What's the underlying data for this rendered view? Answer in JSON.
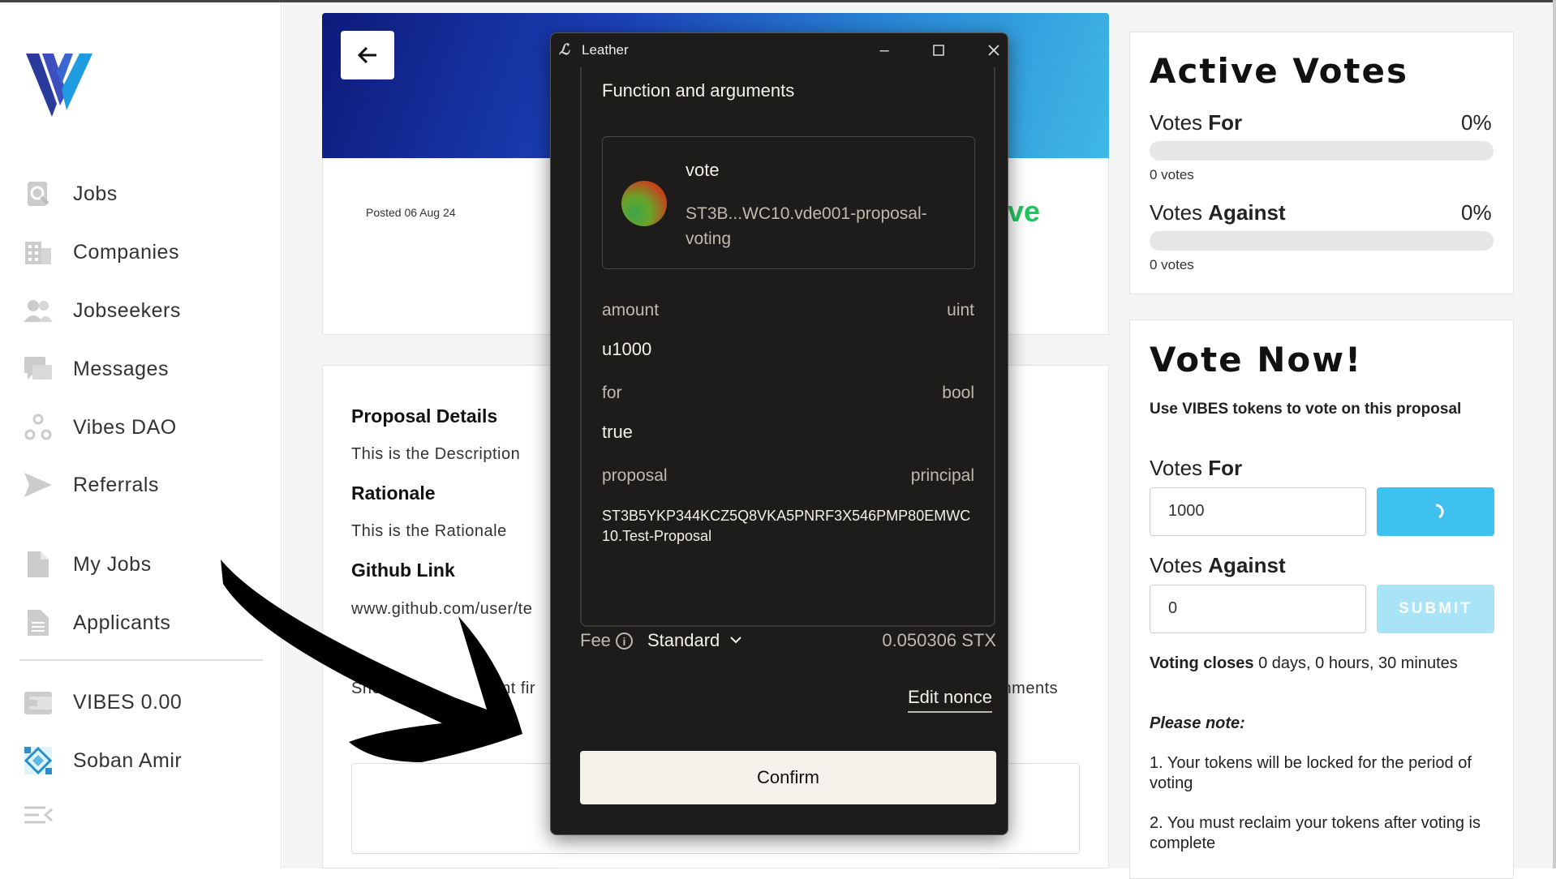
{
  "sidebar": {
    "items": [
      {
        "label": "Jobs",
        "icon": "search-icon"
      },
      {
        "label": "Companies",
        "icon": "building-icon"
      },
      {
        "label": "Jobseekers",
        "icon": "users-icon"
      },
      {
        "label": "Messages",
        "icon": "chat-icon"
      },
      {
        "label": "Vibes DAO",
        "icon": "dao-icon"
      },
      {
        "label": "Referrals",
        "icon": "send-icon"
      },
      {
        "label": "My Jobs",
        "icon": "document-icon"
      },
      {
        "label": "Applicants",
        "icon": "document-lines-icon"
      },
      {
        "label": "VIBES 0.00",
        "icon": "wallet-icon"
      },
      {
        "label": "Soban Amir",
        "icon": "avatar"
      }
    ]
  },
  "proposal": {
    "posted": "Posted 06 Aug 24",
    "status_fragment": "tive",
    "details_heading": "Proposal Details",
    "description": "This is the Description",
    "rationale_heading": "Rationale",
    "rationale": "This is the Rationale",
    "github_heading": "Github Link",
    "github_link": "www.github.com/user/te",
    "show_left": "Show",
    "show_middle": "cent fir",
    "comments_fragment": "mments"
  },
  "active_votes": {
    "title": "Active Votes",
    "for_prefix": "Votes ",
    "for_bold": "For",
    "for_pct": "0%",
    "for_count": "0 votes",
    "against_prefix": "Votes ",
    "against_bold": "Against",
    "against_pct": "0%",
    "against_count": "0 votes"
  },
  "vote_now": {
    "title": "Vote Now!",
    "subtitle": "Use VIBES tokens to vote on this proposal",
    "for_prefix": "Votes ",
    "for_bold": "For",
    "for_value": "1000",
    "against_prefix": "Votes ",
    "against_bold": "Against",
    "against_value": "0",
    "submit_label": "SUBMIT",
    "closes_bold": "Voting closes",
    "closes_rest": " 0 days, 0 hours, 30 minutes",
    "note_heading": "Please note:",
    "note_1": "1. Your tokens will be locked for the period of voting",
    "note_2": "2. You must reclaim your tokens after voting is complete"
  },
  "leather": {
    "app_name": "Leather",
    "section_title": "Function and arguments",
    "function_name": "vote",
    "contract": "ST3B...WC10.vde001-proposal-voting",
    "args": [
      {
        "name": "amount",
        "type": "uint",
        "value": "u1000"
      },
      {
        "name": "for",
        "type": "bool",
        "value": "true"
      },
      {
        "name": "proposal",
        "type": "principal",
        "value": "ST3B5YKP344KCZ5Q8VKA5PNRF3X546PMP80EMWC10.Test-Proposal"
      }
    ],
    "fee_label": "Fee",
    "fee_type": "Standard",
    "fee_amount": "0.050306 STX",
    "edit_nonce": "Edit nonce",
    "confirm": "Confirm"
  },
  "colors": {
    "accent_blue": "#3ec1ee",
    "status_green": "#22c55e",
    "modal_bg": "#1d1c1a"
  }
}
